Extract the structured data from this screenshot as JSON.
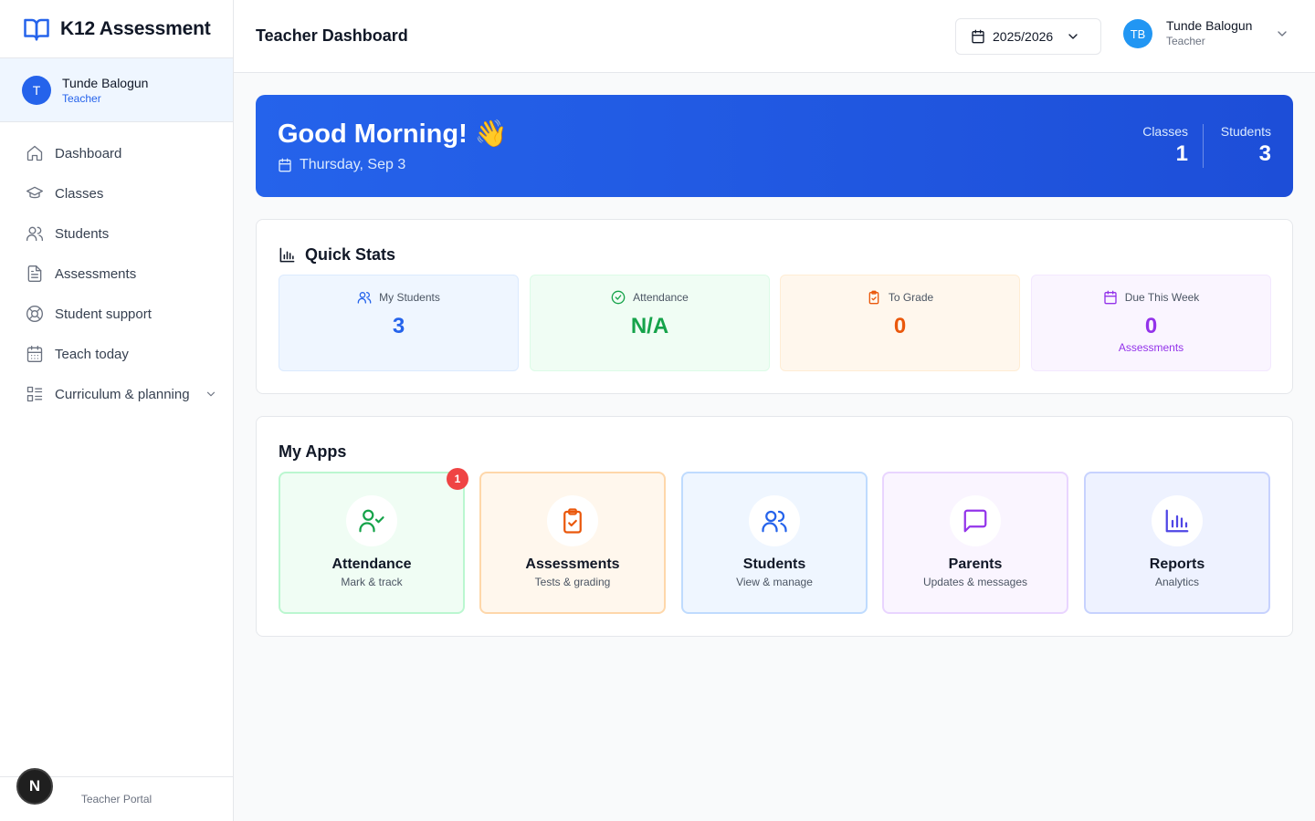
{
  "brand": {
    "title": "K12 Assessment",
    "icon": "book-open-icon"
  },
  "sidebar": {
    "user": {
      "initial": "T",
      "name": "Tunde Balogun",
      "role": "Teacher"
    },
    "items": [
      {
        "label": "Dashboard",
        "icon": "home-icon"
      },
      {
        "label": "Classes",
        "icon": "graduation-cap-icon"
      },
      {
        "label": "Students",
        "icon": "users-icon"
      },
      {
        "label": "Assessments",
        "icon": "file-text-icon"
      },
      {
        "label": "Student support",
        "icon": "lifebuoy-icon"
      },
      {
        "label": "Teach today",
        "icon": "calendar-icon"
      },
      {
        "label": "Curriculum & planning",
        "icon": "list-icon"
      }
    ],
    "footer": "Teacher Portal",
    "dev_badge": "N"
  },
  "header": {
    "title": "Teacher Dashboard",
    "year": "2025/2026",
    "user": {
      "initials": "TB",
      "name": "Tunde Balogun",
      "role": "Teacher"
    }
  },
  "hero": {
    "greeting": "Good Morning! 👋",
    "date": "Thursday, Sep 3",
    "classes_label": "Classes",
    "classes_value": "1",
    "students_label": "Students",
    "students_value": "3"
  },
  "quick_stats": {
    "title": "Quick Stats",
    "items": [
      {
        "label": "My Students",
        "value": "3",
        "color": "#2563eb"
      },
      {
        "label": "Attendance",
        "value": "N/A",
        "color": "#16a34a"
      },
      {
        "label": "To Grade",
        "value": "0",
        "color": "#ea580c"
      },
      {
        "label": "Due This Week",
        "value": "0",
        "sub": "Assessments",
        "color": "#9333ea"
      }
    ]
  },
  "apps": {
    "title": "My Apps",
    "items": [
      {
        "name": "Attendance",
        "sub": "Mark & track",
        "badge": "1",
        "icon": "user-check-icon"
      },
      {
        "name": "Assessments",
        "sub": "Tests & grading",
        "icon": "clipboard-check-icon"
      },
      {
        "name": "Students",
        "sub": "View & manage",
        "icon": "users-icon"
      },
      {
        "name": "Parents",
        "sub": "Updates & messages",
        "icon": "message-square-icon"
      },
      {
        "name": "Reports",
        "sub": "Analytics",
        "icon": "bar-chart-icon"
      }
    ]
  }
}
